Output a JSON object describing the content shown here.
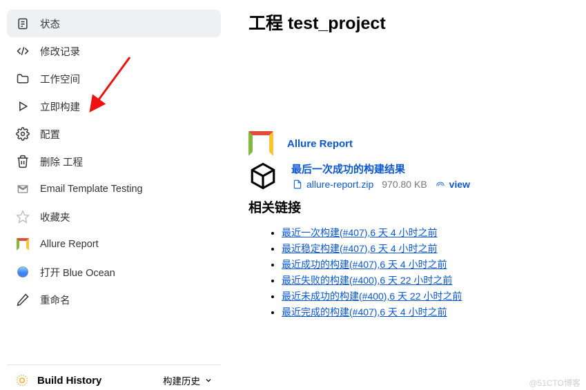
{
  "nav": {
    "items": [
      {
        "label": "状态"
      },
      {
        "label": "修改记录"
      },
      {
        "label": "工作空间"
      },
      {
        "label": "立即构建"
      },
      {
        "label": "配置"
      },
      {
        "label": "删除 工程"
      },
      {
        "label": "Email Template Testing"
      },
      {
        "label": "收藏夹"
      },
      {
        "label": "Allure Report"
      },
      {
        "label": "打开 Blue Ocean"
      },
      {
        "label": "重命名"
      }
    ]
  },
  "build_history": {
    "label": "Build History",
    "sub": "构建历史"
  },
  "page": {
    "title": "工程 test_project"
  },
  "allure": {
    "label": "Allure Report"
  },
  "artifact": {
    "title": "最后一次成功的构建结果",
    "file": "allure-report.zip",
    "size": "970.80 KB",
    "view": "view"
  },
  "section": {
    "links_title": "相关链接"
  },
  "links": [
    "最近一次构建(#407),6 天 4 小时之前",
    "最近稳定构建(#407),6 天 4 小时之前",
    "最近成功的构建(#407),6 天 4 小时之前",
    "最近失败的构建(#400),6 天 22 小时之前",
    "最近未成功的构建(#400),6 天 22 小时之前",
    "最近完成的构建(#407),6 天 4 小时之前"
  ],
  "watermark": "@51CTO博客"
}
